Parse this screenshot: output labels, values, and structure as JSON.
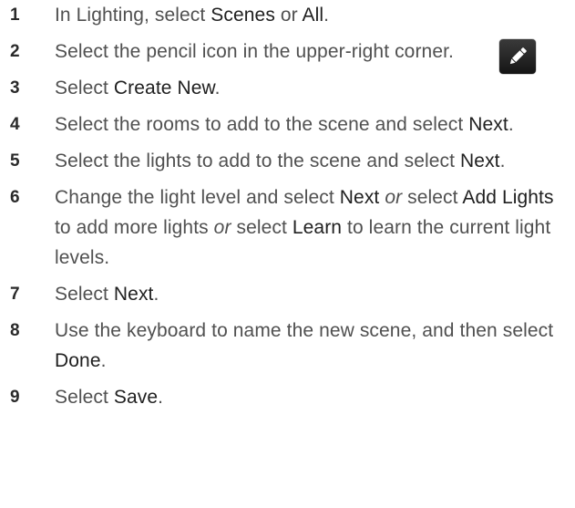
{
  "steps": [
    {
      "num": "1",
      "parts": [
        {
          "t": "In Lighting, select "
        },
        {
          "t": "Scenes",
          "s": "hl"
        },
        {
          "t": " or "
        },
        {
          "t": "All",
          "s": "hl"
        },
        {
          "t": "."
        }
      ]
    },
    {
      "num": "2",
      "parts": [
        {
          "t": "Select the pencil icon in the upper-right corner."
        }
      ],
      "icon": "pencil-icon"
    },
    {
      "num": "3",
      "parts": [
        {
          "t": "Select "
        },
        {
          "t": "Create New",
          "s": "hl"
        },
        {
          "t": "."
        }
      ]
    },
    {
      "num": "4",
      "parts": [
        {
          "t": "Select the rooms to add to the scene and select "
        },
        {
          "t": "Next",
          "s": "hl"
        },
        {
          "t": "."
        }
      ]
    },
    {
      "num": "5",
      "parts": [
        {
          "t": "Select the lights to add to the scene and select "
        },
        {
          "t": "Next",
          "s": "hl"
        },
        {
          "t": "."
        }
      ]
    },
    {
      "num": "6",
      "parts": [
        {
          "t": "Change the light level and select "
        },
        {
          "t": "Next",
          "s": "hl"
        },
        {
          "t": " "
        },
        {
          "t": "or",
          "s": "em"
        },
        {
          "t": " select "
        },
        {
          "t": "Add Lights",
          "s": "hl"
        },
        {
          "t": " to add more lights "
        },
        {
          "t": "or",
          "s": "em"
        },
        {
          "t": " select "
        },
        {
          "t": "Learn",
          "s": "hl"
        },
        {
          "t": " to learn the current light levels."
        }
      ]
    },
    {
      "num": "7",
      "parts": [
        {
          "t": "Select "
        },
        {
          "t": "Next",
          "s": "hl"
        },
        {
          "t": "."
        }
      ]
    },
    {
      "num": "8",
      "parts": [
        {
          "t": "Use the keyboard to name the new scene, and then select "
        },
        {
          "t": "Done",
          "s": "hl"
        },
        {
          "t": "."
        }
      ]
    },
    {
      "num": "9",
      "parts": [
        {
          "t": "Select "
        },
        {
          "t": "Save",
          "s": "hl"
        },
        {
          "t": "."
        }
      ]
    }
  ],
  "colors": {
    "body_text": "#505050",
    "number_text": "#2a2a2a",
    "highlight_text": "#202020",
    "icon_background": "#1f1f1f",
    "icon_glyph": "#ffffff"
  }
}
